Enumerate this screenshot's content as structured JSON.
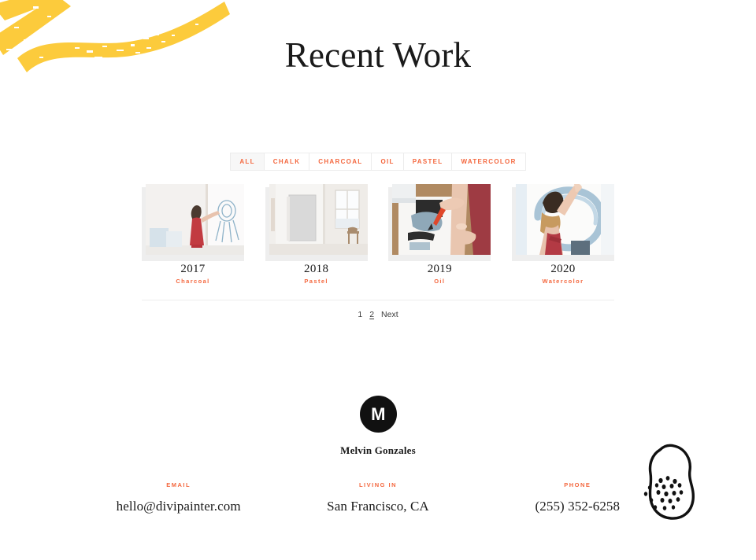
{
  "page": {
    "title": "Recent Work"
  },
  "decorations": {
    "brush_strokes": {
      "icon": "yellow-brush-strokes",
      "color": "#FCCB3C"
    },
    "sponge_doodle": {
      "icon": "sponge-doodle",
      "color": "#111111"
    }
  },
  "filters": {
    "items": [
      {
        "label": "ALL",
        "active": true
      },
      {
        "label": "CHALK",
        "active": false
      },
      {
        "label": "CHARCOAL",
        "active": false
      },
      {
        "label": "OIL",
        "active": false
      },
      {
        "label": "PASTEL",
        "active": false
      },
      {
        "label": "WATERCOLOR",
        "active": false
      }
    ]
  },
  "projects": [
    {
      "year": "2017",
      "category": "Charcoal",
      "image": "woman-painting-large-canvas"
    },
    {
      "year": "2018",
      "category": "Pastel",
      "image": "gray-canvas-on-wall-with-window"
    },
    {
      "year": "2019",
      "category": "Oil",
      "image": "hands-painting-on-paper-with-brush"
    },
    {
      "year": "2020",
      "category": "Watercolor",
      "image": "woman-painting-blue-circle"
    }
  ],
  "pagination": {
    "pages": [
      {
        "label": "1",
        "current": true
      },
      {
        "label": "2",
        "current": false
      }
    ],
    "next_label": "Next"
  },
  "brand": {
    "monogram": "M",
    "name": "Melvin Gonzales"
  },
  "contact": {
    "columns": [
      {
        "label": "EMAIL",
        "value": "hello@divipainter.com"
      },
      {
        "label": "LIVING IN",
        "value": "San Francisco, CA"
      },
      {
        "label": "PHONE",
        "value": "(255) 352-6258"
      }
    ]
  },
  "colors": {
    "accent": "#F4673E",
    "brush_yellow": "#FCCB3C",
    "text": "#1A1A1A",
    "logo_bg": "#111111"
  }
}
